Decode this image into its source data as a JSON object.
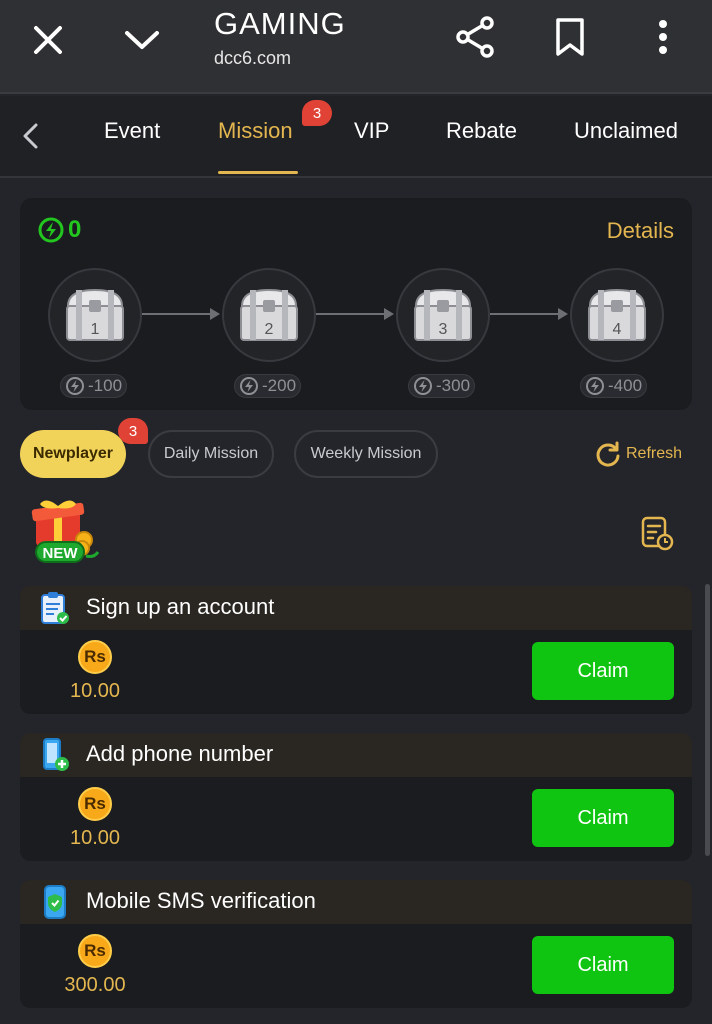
{
  "browser": {
    "title": "GAMING",
    "url": "dcc6.com"
  },
  "tabs": {
    "items": [
      "Event",
      "Mission",
      "VIP",
      "Rebate",
      "Unclaimed"
    ],
    "active": "Mission",
    "mission_badge": "3"
  },
  "progress": {
    "energy": "0",
    "details_label": "Details",
    "chests": [
      {
        "label": "1",
        "cost": "-100"
      },
      {
        "label": "2",
        "cost": "-200"
      },
      {
        "label": "3",
        "cost": "-300"
      },
      {
        "label": "4",
        "cost": "-400"
      }
    ]
  },
  "filters": {
    "newplayer": "Newplayer",
    "newplayer_badge": "3",
    "daily": "Daily Mission",
    "weekly": "Weekly Mission",
    "refresh": "Refresh"
  },
  "new_logo_text": "NEW",
  "missions": [
    {
      "title": "Sign up an account",
      "currency": "Rs",
      "reward": "10.00",
      "button": "Claim",
      "icon": "clipboard-check-icon"
    },
    {
      "title": "Add phone number",
      "currency": "Rs",
      "reward": "10.00",
      "button": "Claim",
      "icon": "phone-add-icon"
    },
    {
      "title": "Mobile SMS verification",
      "currency": "Rs",
      "reward": "300.00",
      "button": "Claim",
      "icon": "phone-shield-icon"
    }
  ],
  "colors": {
    "accent": "#e3b64f",
    "claim": "#10c512",
    "energy": "#22c61f",
    "badge": "#e04336"
  }
}
